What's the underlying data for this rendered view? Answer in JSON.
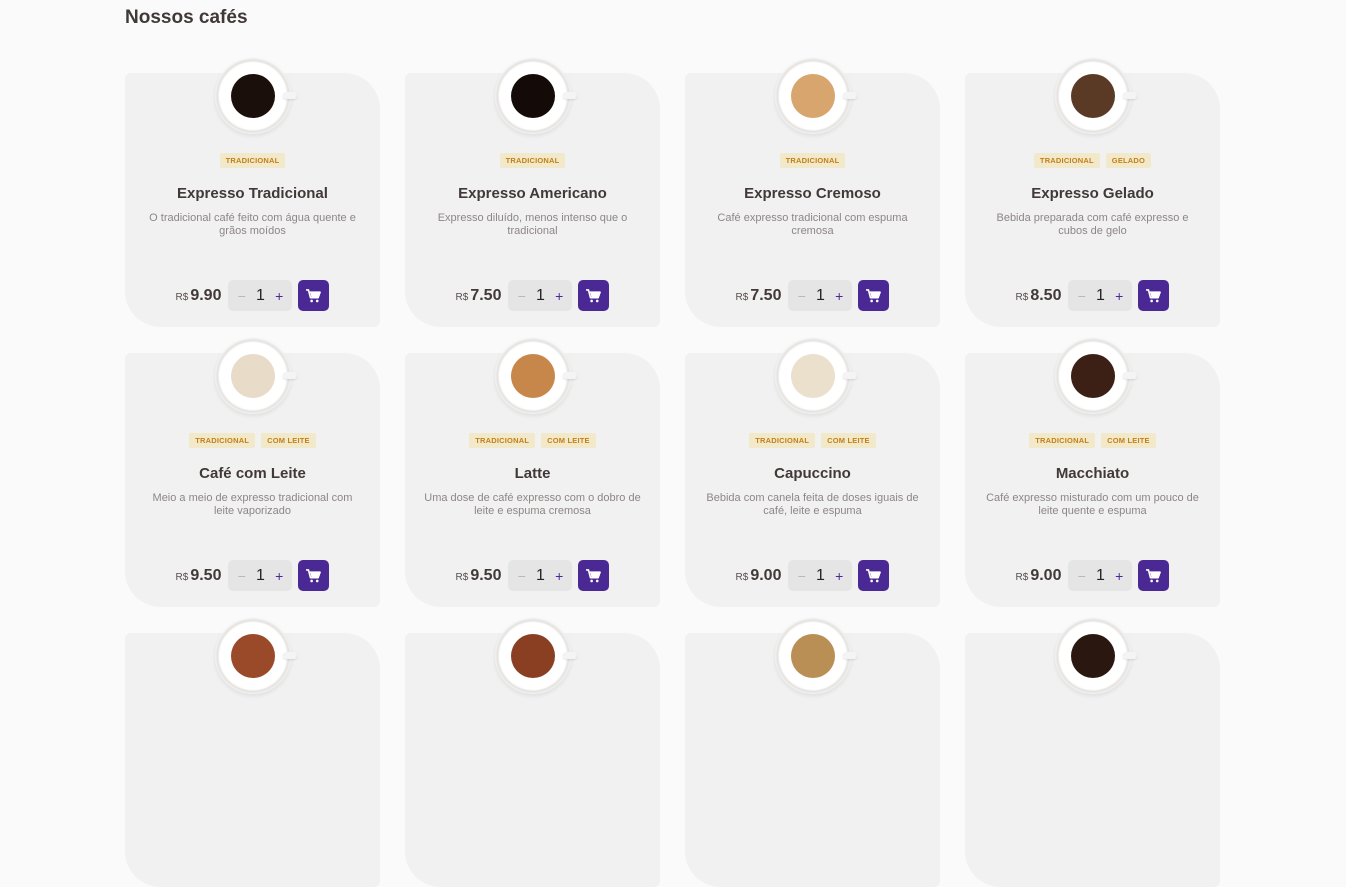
{
  "section": {
    "title": "Nossos cafés"
  },
  "currency": "R$",
  "products": [
    {
      "name": "Expresso Tradicional",
      "tags": [
        "TRADICIONAL"
      ],
      "description": "O tradicional café feito com água quente e grãos moídos",
      "price": "9.90",
      "quantity": "1",
      "coffee_color": "#1a0f0a"
    },
    {
      "name": "Expresso Americano",
      "tags": [
        "TRADICIONAL"
      ],
      "description": "Expresso diluído, menos intenso que o tradicional",
      "price": "7.50",
      "quantity": "1",
      "coffee_color": "#140b08"
    },
    {
      "name": "Expresso Cremoso",
      "tags": [
        "TRADICIONAL"
      ],
      "description": "Café expresso tradicional com espuma cremosa",
      "price": "7.50",
      "quantity": "1",
      "coffee_color": "#d8a56e"
    },
    {
      "name": "Expresso Gelado",
      "tags": [
        "TRADICIONAL",
        "GELADO"
      ],
      "description": "Bebida preparada com café expresso e cubos de gelo",
      "price": "8.50",
      "quantity": "1",
      "coffee_color": "#5a3a24"
    },
    {
      "name": "Café com Leite",
      "tags": [
        "TRADICIONAL",
        "COM LEITE"
      ],
      "description": "Meio a meio de expresso tradicional com leite vaporizado",
      "price": "9.50",
      "quantity": "1",
      "coffee_color": "#e8dcc8"
    },
    {
      "name": "Latte",
      "tags": [
        "TRADICIONAL",
        "COM LEITE"
      ],
      "description": "Uma dose de café expresso com o dobro de leite e espuma cremosa",
      "price": "9.50",
      "quantity": "1",
      "coffee_color": "#c8874a"
    },
    {
      "name": "Capuccino",
      "tags": [
        "TRADICIONAL",
        "COM LEITE"
      ],
      "description": "Bebida com canela feita de doses iguais de café, leite e espuma",
      "price": "9.00",
      "quantity": "1",
      "coffee_color": "#ebe0cc"
    },
    {
      "name": "Macchiato",
      "tags": [
        "TRADICIONAL",
        "COM LEITE"
      ],
      "description": "Café expresso misturado com um pouco de leite quente e espuma",
      "price": "9.00",
      "quantity": "1",
      "coffee_color": "#3c2015"
    }
  ],
  "partial_row_coffee_colors": [
    "#9a4a28",
    "#8a3f22",
    "#b98f55",
    "#2a1810"
  ],
  "colors": {
    "accent": "#4b2995",
    "tag_bg": "#f1e9c9",
    "tag_text": "#c47f17",
    "card_bg": "#f1f1f1"
  }
}
